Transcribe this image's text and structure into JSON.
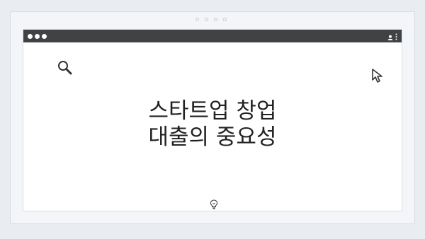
{
  "page": {
    "headline_line1": "스타트업 창업",
    "headline_line2": "대출의 중요성"
  },
  "window": {
    "titlebar_color": "#404244",
    "traffic_lights": [
      "dot",
      "dot",
      "dot"
    ],
    "right_icons": [
      "user-icon",
      "menu-dots-icon"
    ]
  },
  "icons": {
    "search": "search-icon",
    "cursor": "cursor-icon",
    "bulb": "lightbulb-icon"
  },
  "colors": {
    "background": "#e9edf2",
    "card": "#ffffff",
    "text": "#222222"
  }
}
